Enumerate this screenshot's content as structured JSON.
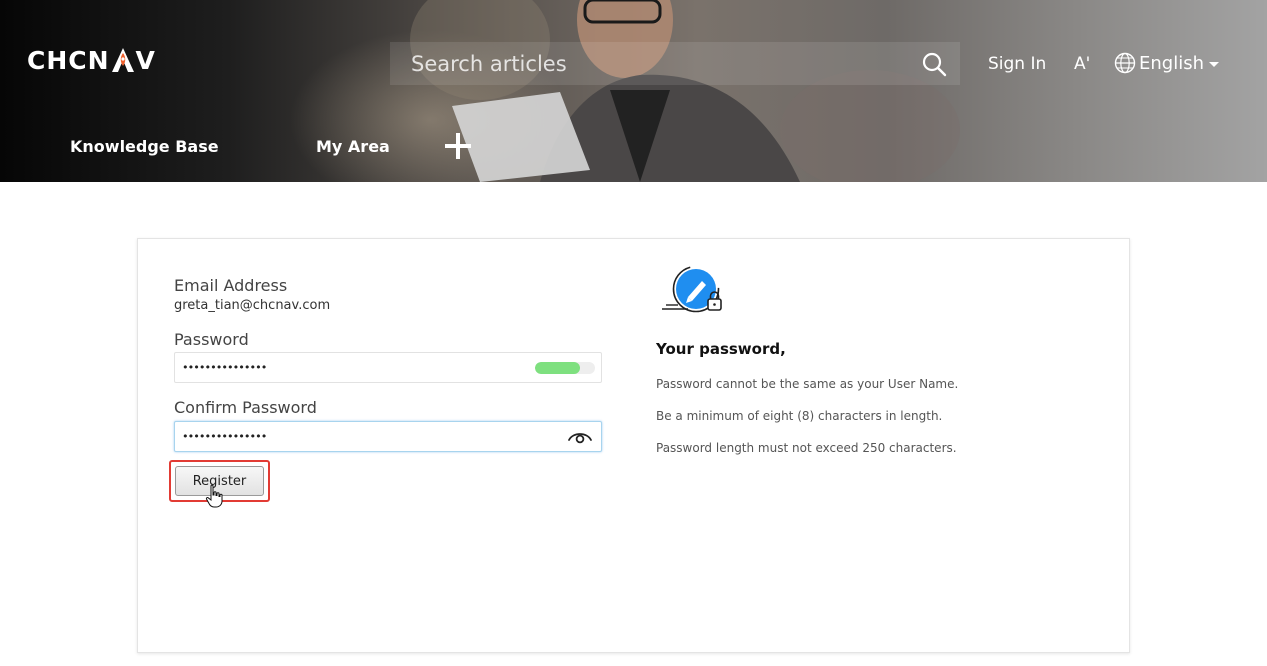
{
  "header": {
    "logo": {
      "text_left": "CHCN",
      "text_right": "V"
    },
    "search": {
      "placeholder": "Search articles"
    },
    "sign_in": "Sign In",
    "font_size_icon": "A'",
    "language": "English",
    "nav": [
      {
        "label": "Knowledge Base"
      },
      {
        "label": "My Area"
      }
    ]
  },
  "form": {
    "email_label": "Email Address",
    "email_value": "greta_tian@chcnav.com",
    "password_label": "Password",
    "password_value": "•••••••••••••••",
    "strength_level": 0.75,
    "strength_color": "#7ee07f",
    "confirm_label": "Confirm Password",
    "confirm_value": "•••••••••••••••",
    "register_label": "Register",
    "highlight_color": "#e23b34"
  },
  "rules": {
    "title": "Your password,",
    "items": [
      "Password cannot be the same as your User Name.",
      "Be a minimum of eight (8) characters in length.",
      "Password length must not exceed 250 characters."
    ]
  },
  "colors": {
    "brand_orange": "#f0612d",
    "icon_blue": "#1f8ef0"
  }
}
